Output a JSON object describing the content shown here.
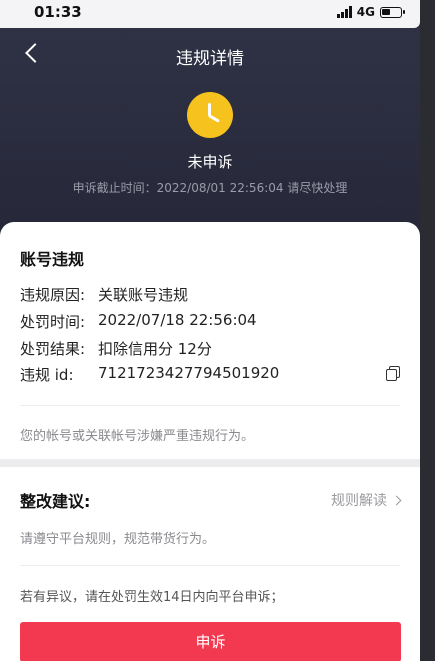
{
  "status_bar": {
    "time": "01:33",
    "network": "4G"
  },
  "header": {
    "title": "违规详情",
    "status": "未申诉",
    "deadline": "申诉截止时间：2022/08/01 22:56:04 请尽快处理"
  },
  "violation": {
    "section_title": "账号违规",
    "rows": [
      {
        "key": "违规原因:",
        "value": "关联账号违规"
      },
      {
        "key": "处罚时间:",
        "value": "2022/07/18 22:56:04"
      },
      {
        "key": "处罚结果:",
        "value": "扣除信用分 12分"
      },
      {
        "key": "违规 id:",
        "value": "7121723427794501920"
      }
    ],
    "note": "您的帐号或关联帐号涉嫌严重违规行为。"
  },
  "suggestion": {
    "section_title": "整改建议:",
    "rules_link": "规则解读",
    "note": "请遵守平台规则，规范带货行为。",
    "objection_note": "若有异议，请在处罚生效14日内向平台申诉；",
    "appeal_button": "申诉"
  },
  "colors": {
    "header_bg": "#2f3145",
    "clock": "#f6c21e",
    "appeal_button": "#f2394f"
  },
  "icons": [
    "back-icon",
    "clock-icon",
    "copy-icon",
    "chevron-right-icon",
    "signal-icon",
    "battery-icon"
  ]
}
